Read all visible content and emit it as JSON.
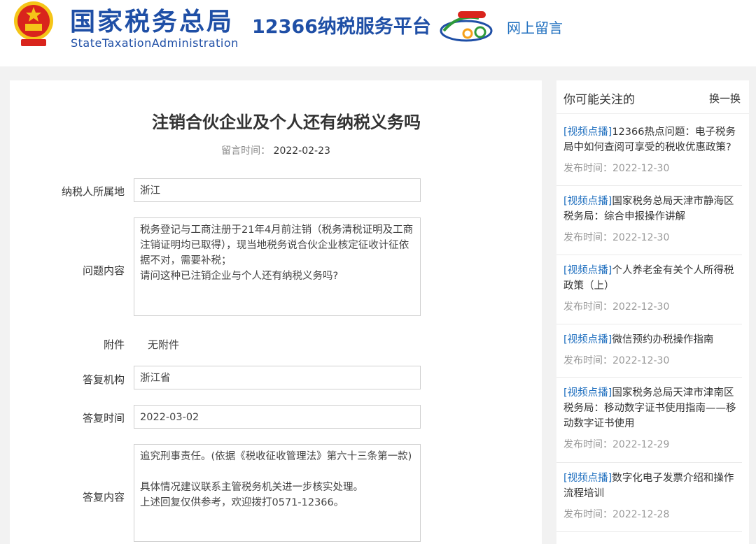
{
  "header": {
    "site_name_cn": "国家税务总局",
    "site_name_en": "StateTaxationAdministration",
    "platform": "12366纳税服务平台",
    "section_link": "网上留言"
  },
  "question": {
    "title": "注销合伙企业及个人还有纳税义务吗",
    "time_label": "留言时间：",
    "time_value": "2022-02-23",
    "fields": {
      "location": {
        "label": "纳税人所属地",
        "value": "浙江"
      },
      "content": {
        "label": "问题内容",
        "value": "税务登记与工商注册于21年4月前注销（税务清税证明及工商注销证明均已取得），现当地税务说合伙企业核定征收计征依据不对，需要补税；\n请问这种已注销企业与个人还有纳税义务吗?"
      },
      "attachment": {
        "label": "附件",
        "value": "无附件"
      },
      "agency": {
        "label": "答复机构",
        "value": "浙江省"
      },
      "reply_time": {
        "label": "答复时间",
        "value": "2022-03-02"
      },
      "reply_content": {
        "label": "答复内容",
        "value": "追究刑事责任。(依据《税收征收管理法》第六十三条第一款)\n\n具体情况建议联系主管税务机关进一步核实处理。\n上述回复仅供参考，欢迎拨打0571-12366。"
      }
    }
  },
  "sidebar": {
    "title": "你可能关注的",
    "refresh": "换一换",
    "items": [
      {
        "tag": "[视频点播]",
        "text": "12366热点问题：电子税务局中如何查阅可享受的税收优惠政策?",
        "date_label": "发布时间：",
        "date": "2022-12-30"
      },
      {
        "tag": "[视频点播]",
        "text": "国家税务总局天津市静海区税务局：综合申报操作讲解",
        "date_label": "发布时间：",
        "date": "2022-12-30"
      },
      {
        "tag": "[视频点播]",
        "text": "个人养老金有关个人所得税政策（上）",
        "date_label": "发布时间：",
        "date": "2022-12-30"
      },
      {
        "tag": "[视频点播]",
        "text": "微信预约办税操作指南",
        "date_label": "发布时间：",
        "date": "2022-12-30"
      },
      {
        "tag": "[视频点播]",
        "text": "国家税务总局天津市津南区税务局：移动数字证书使用指南——移动数字证书使用",
        "date_label": "发布时间：",
        "date": "2022-12-29"
      },
      {
        "tag": "[视频点播]",
        "text": "数字化电子发票介绍和操作流程培训",
        "date_label": "发布时间：",
        "date": "2022-12-28"
      }
    ]
  },
  "colors": {
    "brand_blue": "#1f4fa6",
    "link_blue": "#1f6fbf",
    "emblem_red": "#d9241c",
    "emblem_gold": "#f5c518"
  },
  "icons": {
    "emblem": "national-emblem-icon",
    "platform_logo": "12366-logo-icon"
  }
}
